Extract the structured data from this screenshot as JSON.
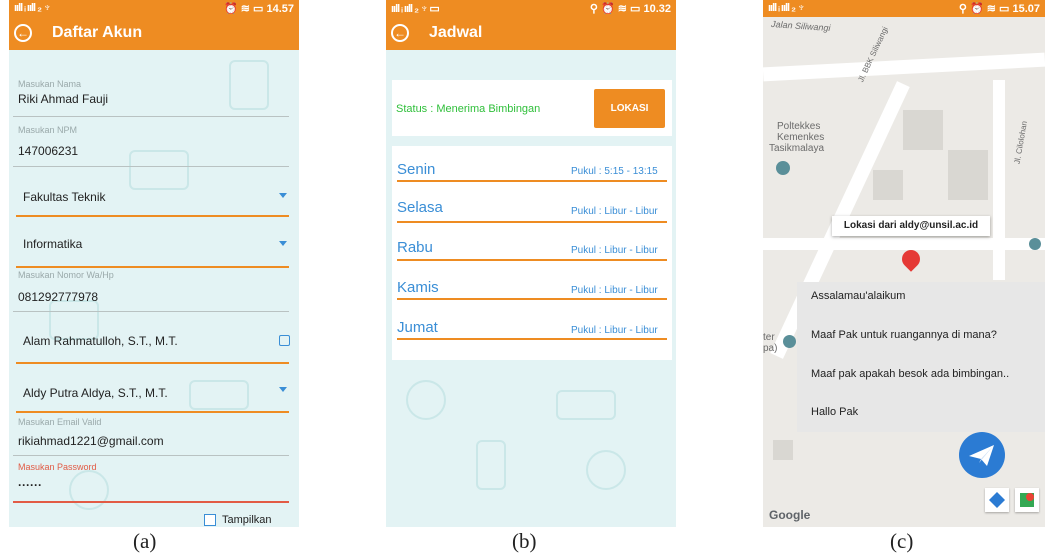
{
  "panel_a": {
    "status_left": "ııll ᵢ ııll ₂ ♆",
    "status_right": "⏰ ≋ ▭ 14.57",
    "title": "Daftar Akun",
    "fields": [
      {
        "label": "Masukan Nama",
        "value": "Riki Ahmad Fauji"
      },
      {
        "label": "Masukan NPM",
        "value": "147006231"
      }
    ],
    "faculty": "Fakultas Teknik",
    "program": "Informatika",
    "phone_label": "Masukan Nomor Wa/Hp",
    "phone": "081292777978",
    "advisor1": "Alam Rahmatulloh, S.T., M.T.",
    "advisor2": "Aldy Putra Aldya, S.T., M.T.",
    "email_label": "Masukan Email Valid",
    "email": "rikiahmad1221@gmail.com",
    "password_label": "Masukan Password",
    "password": "······",
    "show_label": "Tampilkan"
  },
  "panel_b": {
    "status_left": "ııll ᵢ ııll ₂ ♆ ▭",
    "status_right": "⚲ ⏰ ≋ ▭ 10.32",
    "title": "Jadwal",
    "status_label": "Status : Menerima Bimbingan",
    "button": "LOKASI",
    "schedule": [
      {
        "day": "Senin",
        "time": "Pukul : 5:15 - 13:15"
      },
      {
        "day": "Selasa",
        "time": "Pukul : Libur - Libur"
      },
      {
        "day": "Rabu",
        "time": "Pukul : Libur - Libur"
      },
      {
        "day": "Kamis",
        "time": "Pukul : Libur - Libur"
      },
      {
        "day": "Jumat",
        "time": "Pukul : Libur - Libur"
      }
    ]
  },
  "panel_c": {
    "status_left": "ııll ᵢ ııll ₂ ♆",
    "status_right": "⚲ ⏰ ≋ ▭ 15.07",
    "street1": "Jalan Siliwangi",
    "street2": "Jl. BBK Siliwangi",
    "street3": "Jl. Cilolohan",
    "place": [
      "Poltekkes",
      "Kemenkes",
      "Tasikmalaya"
    ],
    "place2": [
      "ter",
      "pa)"
    ],
    "marker_label": "Lokasi dari aldy@unsil.ac.id",
    "messages": [
      "Assalamau'alaikum",
      "Maaf Pak untuk ruangannya di mana?",
      "Maaf pak apakah besok ada bimbingan..",
      "Hallo Pak"
    ],
    "brand": "Google"
  },
  "captions": [
    "(a)",
    "(b)",
    "(c)"
  ],
  "colors": {
    "accent": "#ee8c22",
    "link": "#3a8ed6",
    "status_ok": "#2fbf3a",
    "fab": "#2b7bd3",
    "pin": "#e53935"
  }
}
